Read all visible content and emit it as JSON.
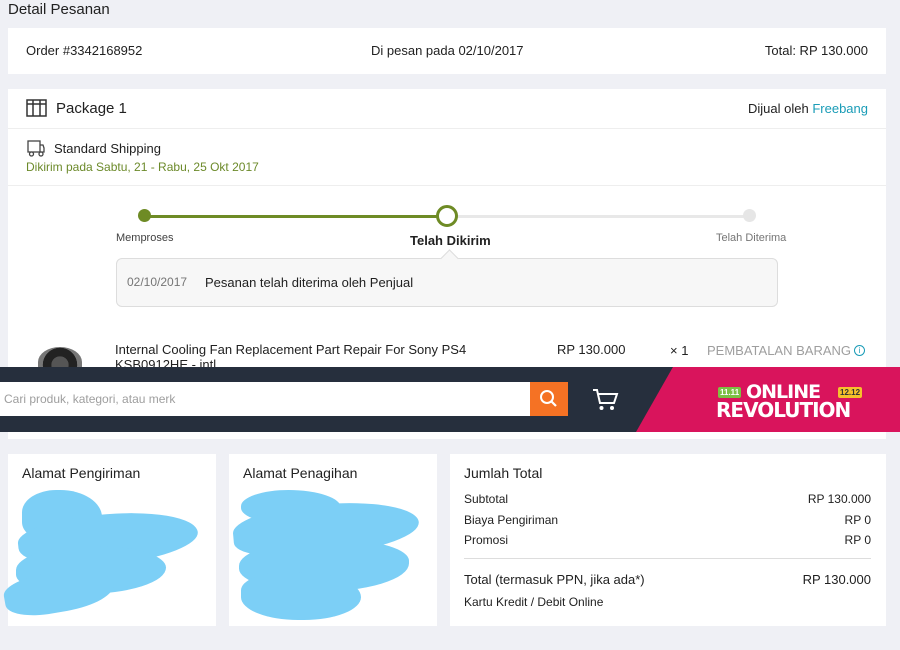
{
  "page": {
    "title": "Detail Pesanan"
  },
  "order": {
    "number": "Order #3342168952",
    "placed": "Di pesan pada 02/10/2017",
    "total": "Total: RP 130.000"
  },
  "package": {
    "title": "Package 1",
    "seller_prefix": "Dijual oleh ",
    "seller_name": "Freebang",
    "shipping_method": "Standard Shipping",
    "shipping_date": "Dikirim pada Sabtu, 21 - Rabu, 25 Okt 2017"
  },
  "tracking": {
    "steps": [
      "Memproses",
      "Telah Dikirim",
      "Telah Diterima"
    ],
    "status_date": "02/10/2017",
    "status_text": "Pesanan telah diterima oleh Penjual"
  },
  "item": {
    "name_line1": "Internal Cooling Fan Replacement Part Repair For Sony PS4",
    "name_line2": "KSB0912HE - intl",
    "price": "RP 130.000",
    "qty": "× 1",
    "cancel_label": "PEMBATALAN BARANG"
  },
  "navbar": {
    "search_placeholder": "Cari produk, kategori, atau merk",
    "promo_badge_left": "11.11",
    "promo_badge_right": "12.12",
    "promo_line1": "ONLINE",
    "promo_line2": "REVOLUTION"
  },
  "addresses": {
    "shipping_title": "Alamat Pengiriman",
    "billing_title": "Alamat Penagihan"
  },
  "totals": {
    "title": "Jumlah Total",
    "subtotal_label": "Subtotal",
    "subtotal_value": "RP 130.000",
    "shipping_label": "Biaya Pengiriman",
    "shipping_value": "RP 0",
    "promo_label": "Promosi",
    "promo_value": "RP 0",
    "grand_label": "Total (termasuk PPN, jika ada*)",
    "grand_value": "RP 130.000",
    "payment_method": "Kartu Kredit / Debit Online"
  },
  "colors": {
    "accent_green": "#6e8b25",
    "link_blue": "#1a9cb7",
    "search_orange": "#f57224",
    "navbar_dark": "#262f3d",
    "promo_pink": "#d9145c"
  }
}
